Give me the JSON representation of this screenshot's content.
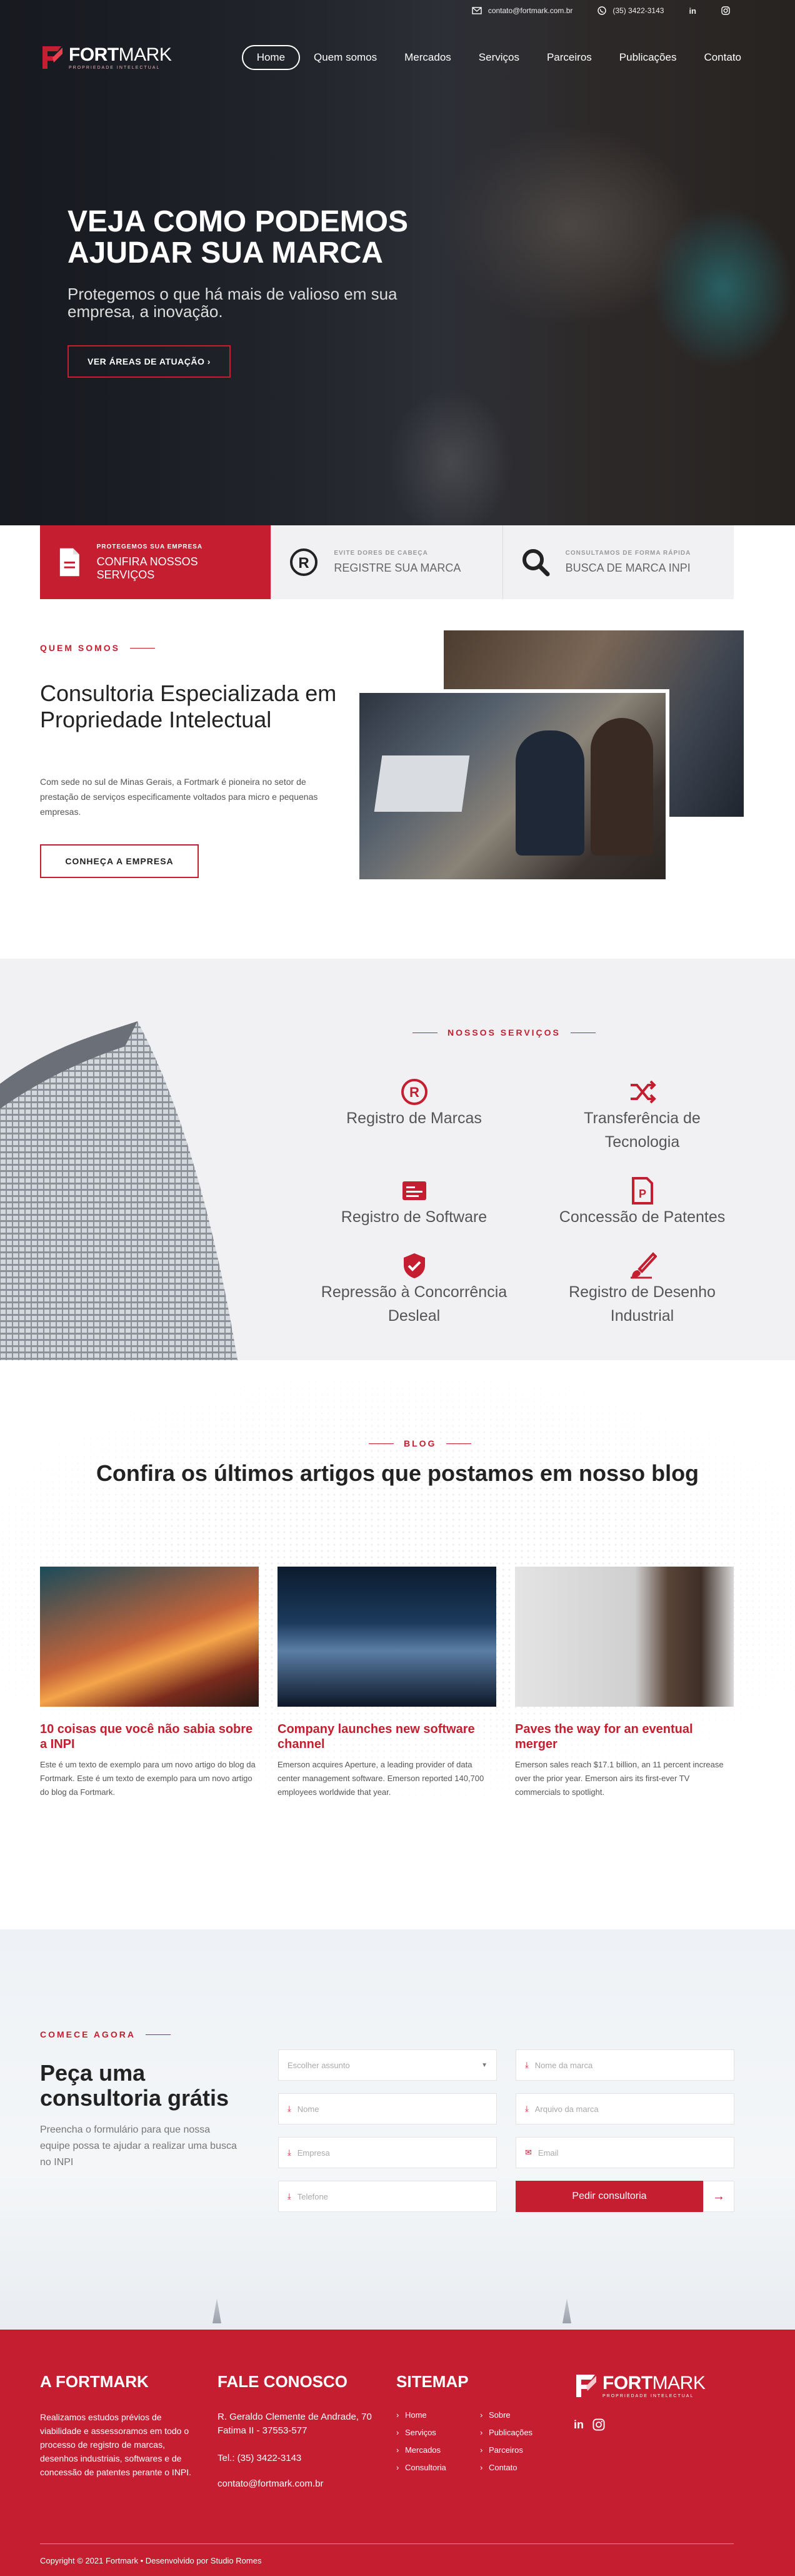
{
  "topbar": {
    "email": "contato@fortmark.com.br",
    "phone": "(35) 3422-3143"
  },
  "brand": {
    "name_bold": "FORT",
    "name_light": "MARK",
    "tagline": "PROPRIEDADE INTELECTUAL"
  },
  "nav": [
    "Home",
    "Quem somos",
    "Mercados",
    "Serviços",
    "Parceiros",
    "Publicações",
    "Contato"
  ],
  "hero": {
    "title": "VEJA COMO PODEMOS AJUDAR SUA MARCA",
    "subtitle": "Protegemos o que há mais de valioso em sua empresa, a inovação.",
    "cta": "VER ÁREAS DE ATUAÇÃO ›"
  },
  "cards": [
    {
      "small": "PROTEGEMOS SUA EMPRESA",
      "big": "CONFIRA NOSSOS SERVIÇOS",
      "icon": "document-icon"
    },
    {
      "small": "EVITE DORES DE CABEÇA",
      "big": "REGISTRE SUA MARCA",
      "icon": "registered-icon"
    },
    {
      "small": "CONSULTAMOS DE FORMA RÁPIDA",
      "big": "BUSCA DE MARCA INPI",
      "icon": "search-icon"
    }
  ],
  "about": {
    "kicker": "QUEM SOMOS",
    "title": "Consultoria Especializada em Propriedade Intelectual",
    "text": "Com sede no sul de Minas Gerais, a Fortmark é pioneira no setor de prestação de serviços especificamente voltados para micro e pequenas empresas.",
    "button": "CONHEÇA A EMPRESA"
  },
  "services": {
    "kicker": "NOSSOS SERVIÇOS",
    "items": [
      "Registro de Marcas",
      "Transferência de Tecnologia",
      "Registro de Software",
      "Concessão de Patentes",
      "Repressão à Concorrência Desleal",
      "Registro de Desenho Industrial"
    ]
  },
  "blog": {
    "kicker": "BLOG",
    "title": "Confira os últimos artigos que postamos em nosso blog",
    "posts": [
      {
        "title": "10 coisas que você não sabia sobre a INPI",
        "excerpt": "Este é um texto de exemplo para um novo artigo do blog da Fortmark. Este é um texto de exemplo para um novo artigo do blog da Fortmark."
      },
      {
        "title": "Company launches new software channel",
        "excerpt": "Emerson acquires Aperture, a leading provider of data center management software. Emerson reported 140,700 employees worldwide that year."
      },
      {
        "title": "Paves the way for an eventual merger",
        "excerpt": "Emerson sales reach $17.1 billion, an 11 percent increase over the prior year. Emerson airs its first-ever TV commercials to spotlight."
      }
    ]
  },
  "contact": {
    "kicker": "COMECE AGORA",
    "title": "Peça uma consultoria grátis",
    "text": "Preencha o formulário para que nossa equipe possa te ajudar a realizar uma busca no INPI",
    "fields": {
      "assunto": "Escolher assunto",
      "marca": "Nome da marca",
      "nome": "Nome",
      "arquivo": "Arquivo da marca",
      "empresa": "Empresa",
      "email": "Email",
      "telefone": "Telefone"
    },
    "submit": "Pedir consultoria"
  },
  "footer": {
    "about_title": "A FORTMARK",
    "about_text": "Realizamos estudos prévios de viabilidade e assessoramos em todo o processo de registro de marcas, desenhos industriais, softwares e de concessão de patentes perante o INPI.",
    "contact_title": "FALE CONOSCO",
    "address": "R. Geraldo Clemente de Andrade, 70 Fatima II - 37553-577",
    "tel": "Tel.: (35) 3422-3143",
    "email": "contato@fortmark.com.br",
    "sitemap_title": "SITEMAP",
    "sitemap": [
      "Home",
      "Sobre",
      "Serviços",
      "Publicações",
      "Mercados",
      "Parceiros",
      "Consultoria",
      "Contato"
    ],
    "copyright": "Copyright © 2021 Fortmark • Desenvolvido por Studio Romes"
  },
  "colors": {
    "accent": "#c41e30"
  }
}
